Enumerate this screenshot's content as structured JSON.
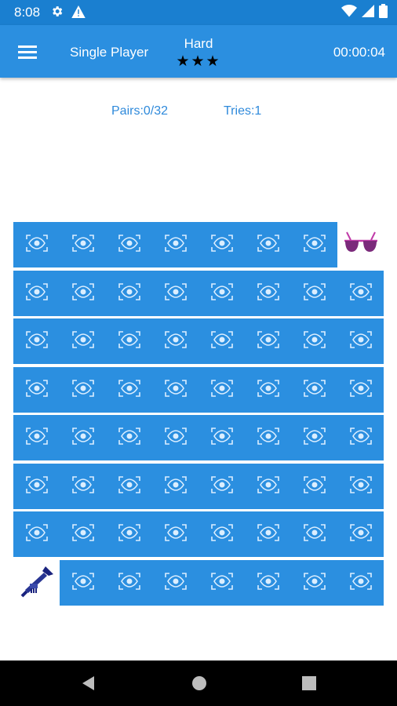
{
  "status_bar": {
    "time": "8:08",
    "icons": [
      "gear-icon",
      "warning-icon",
      "wifi-icon",
      "signal-icon",
      "battery-icon"
    ]
  },
  "app_bar": {
    "title": "Single Player",
    "difficulty": "Hard",
    "stars": "★★★",
    "timer": "00:00:04",
    "color": "#2b8fe0"
  },
  "stats": {
    "pairs": "Pairs:0/32",
    "tries": "Tries:1"
  },
  "board": {
    "rows": 8,
    "cols": 8,
    "card_back_color": "#2b8fe0",
    "revealed": [
      {
        "row": 0,
        "col": 7,
        "icon": "sunglasses-icon"
      },
      {
        "row": 7,
        "col": 0,
        "icon": "trumpet-icon"
      }
    ]
  },
  "nav_bar": {
    "icons": [
      "back-icon",
      "home-icon",
      "recents-icon"
    ]
  }
}
